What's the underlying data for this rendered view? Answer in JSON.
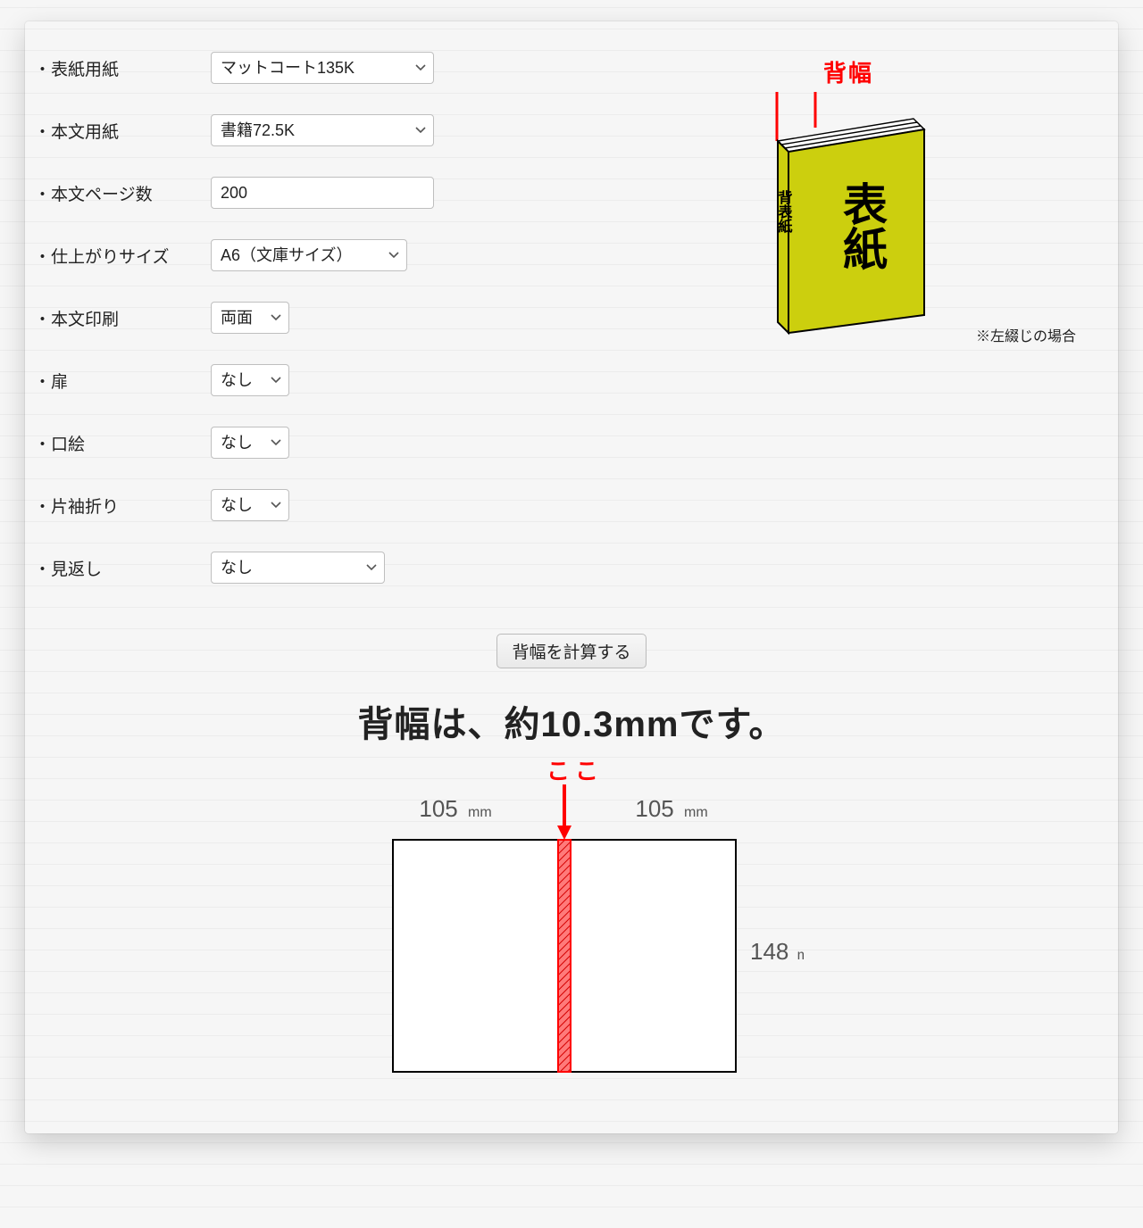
{
  "form": {
    "cover_paper": {
      "label": "表紙用紙",
      "value": "マットコート135K"
    },
    "body_paper": {
      "label": "本文用紙",
      "value": "書籍72.5K"
    },
    "page_count": {
      "label": "本文ページ数",
      "value": "200"
    },
    "finish_size": {
      "label": "仕上がりサイズ",
      "value": "A6（文庫サイズ）"
    },
    "body_print": {
      "label": "本文印刷",
      "value": "両面"
    },
    "tobira": {
      "label": "扉",
      "value": "なし"
    },
    "kuchie": {
      "label": "口絵",
      "value": "なし"
    },
    "katasode": {
      "label": "片袖折り",
      "value": "なし"
    },
    "mikaeshi": {
      "label": "見返し",
      "value": "なし"
    }
  },
  "book3d": {
    "spine_label": "背幅",
    "spine_text": "背表紙",
    "front_text": "表紙",
    "note": "※左綴じの場合"
  },
  "calc_button": "背幅を計算する",
  "result_text": "背幅は、約10.3mmです。",
  "spread": {
    "here_label": "ここ",
    "left_label": "105",
    "right_label": "105",
    "height_label": "148",
    "unit": "mm"
  }
}
